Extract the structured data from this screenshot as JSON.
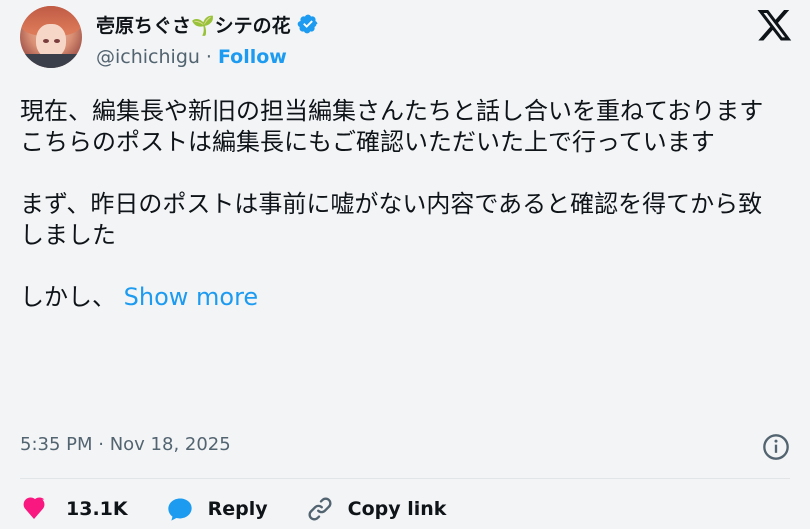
{
  "author": {
    "display_name": "壱原ちぐさ🌱シテの花",
    "handle": "@ichichigu",
    "separator": "·",
    "follow_label": "Follow",
    "verified": true,
    "avatar_icon": "avatar-icon"
  },
  "brand": {
    "logo_icon": "x-logo-icon"
  },
  "tweet": {
    "text": "現在、編集長や新旧の担当編集さんたちと話し合いを重ねております\nこちらのポストは編集長にもご確認いただいた上で行っています\n\nまず、昨日のポストは事前に嘘がない内容であると確認を得てから致しました\n\nしかし、 ",
    "show_more_label": "Show more",
    "timestamp": "5:35 PM · Nov 18, 2025"
  },
  "actions": {
    "like_count": "13.1K",
    "reply_label": "Reply",
    "copy_link_label": "Copy link"
  },
  "colors": {
    "accent": "#1d9bf0",
    "like": "#f91880",
    "text": "#0f1419",
    "secondary": "#536471",
    "background": "#f3f4f6"
  }
}
